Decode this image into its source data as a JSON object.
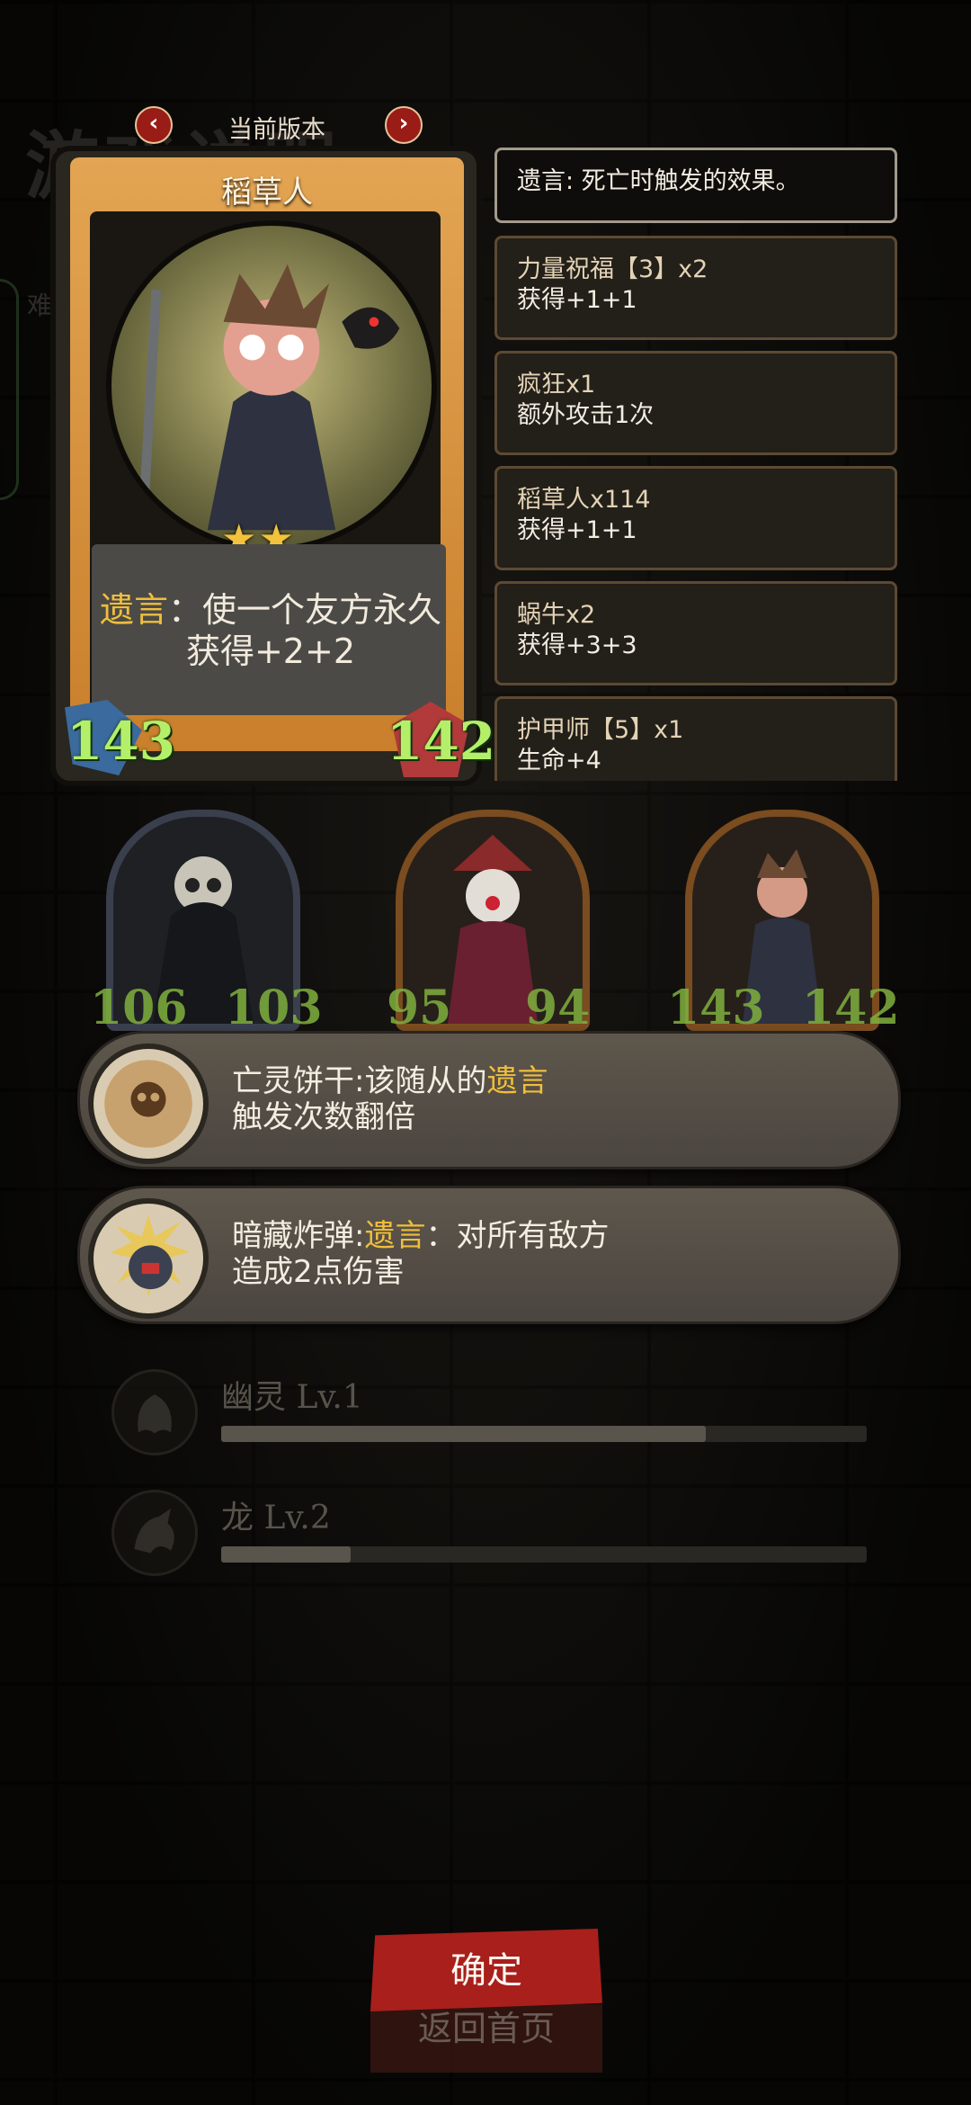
{
  "background": {
    "title": "游戏说明",
    "side_label": "难"
  },
  "version": {
    "label": "当前版本",
    "prev_icon": "chevron-left-icon",
    "next_icon": "chevron-right-icon"
  },
  "card": {
    "name": "稻草人",
    "stars": "★★",
    "star_count": 2,
    "keyword": "遗言",
    "desc_line1": "：使一个友方永久",
    "desc_line2": "获得+2+2",
    "attack": "143",
    "health": "142"
  },
  "effects": {
    "header": "遗言: 死亡时触发的效果。",
    "items": [
      {
        "title": "力量祝福【3】x2",
        "sub": "获得+1+1"
      },
      {
        "title": "疯狂x1",
        "sub": "额外攻击1次"
      },
      {
        "title": "稻草人x114",
        "sub": "获得+1+1"
      },
      {
        "title": "蜗牛x2",
        "sub": "获得+3+3"
      },
      {
        "title": "护甲师【5】x1",
        "sub": "生命+4"
      }
    ]
  },
  "minions": [
    {
      "attack": "106",
      "health": "103"
    },
    {
      "attack": "95",
      "health": "94"
    },
    {
      "attack": "143",
      "health": "142"
    }
  ],
  "relics": [
    {
      "icon": "skull-cookie-icon",
      "line1_a": "亡灵饼干:该随从的",
      "line1_kw": "遗言",
      "line1_b": "",
      "line2": "触发次数翻倍"
    },
    {
      "icon": "bomb-icon",
      "line1_a": "暗藏炸弹:",
      "line1_kw": "遗言",
      "line1_b": "：对所有敌方",
      "line2": "造成2点伤害"
    }
  ],
  "tribes": [
    {
      "icon": "ghost-icon",
      "label": "幽灵 Lv.1",
      "progress": 0.75
    },
    {
      "icon": "dragon-icon",
      "label": "龙 Lv.2",
      "progress": 0.2
    }
  ],
  "buttons": {
    "confirm": "确定",
    "home": "返回首页"
  },
  "colors": {
    "stat_green": "#b4ef6a",
    "keyword_gold": "#f0be3c",
    "confirm_red": "#a81f1c"
  }
}
